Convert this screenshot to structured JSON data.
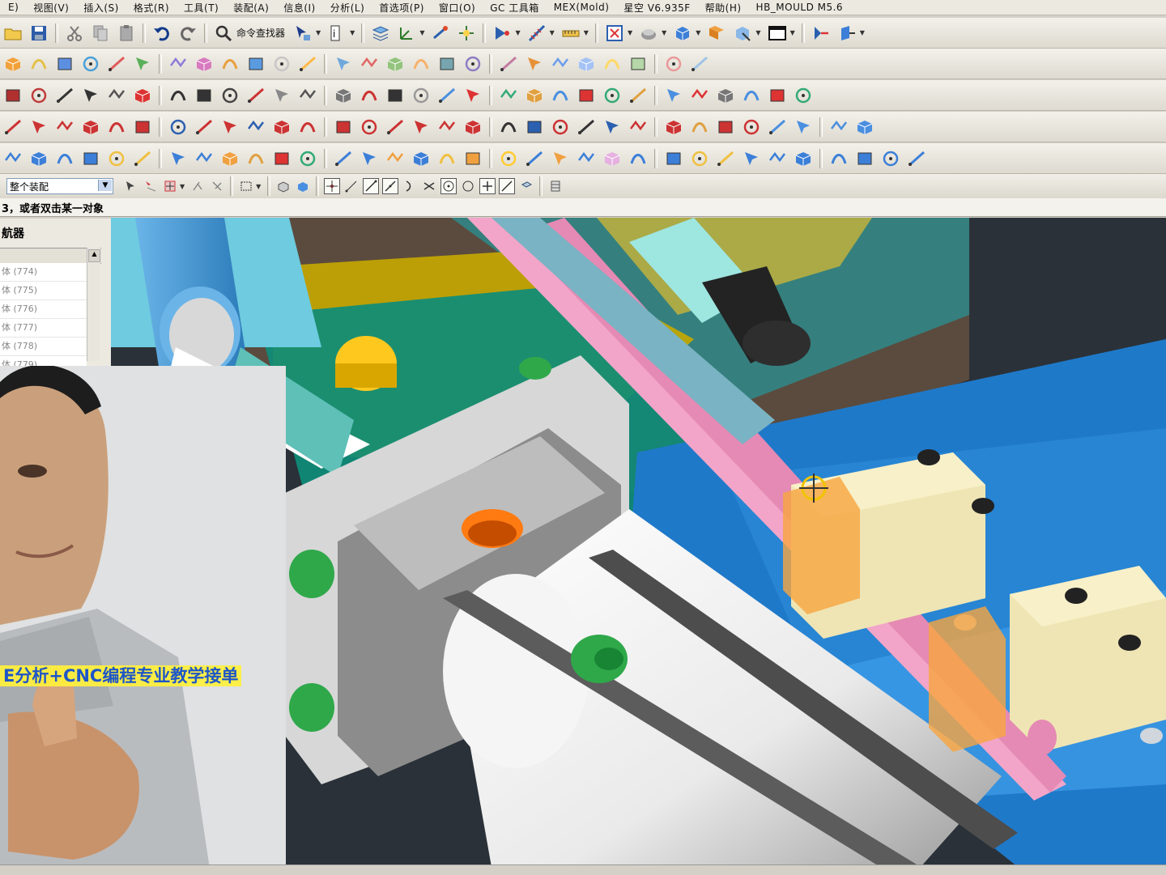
{
  "menubar": {
    "items": [
      "E)",
      "视图(V)",
      "插入(S)",
      "格式(R)",
      "工具(T)",
      "装配(A)",
      "信息(I)",
      "分析(L)",
      "首选项(P)",
      "窗口(O)",
      "GC 工具箱",
      "MEX(Mold)",
      "星空 V6.935F",
      "帮助(H)",
      "HB_MOULD M5.6"
    ]
  },
  "toolbar1": {
    "command_finder_label": "命令查找器"
  },
  "selection_bar": {
    "filter_value": "整个装配"
  },
  "cue_line": {
    "text": "3，或者双击某一对象"
  },
  "navigator": {
    "title": "航器",
    "rows": [
      "体 (774)",
      "体 (775)",
      "体 (776)",
      "体 (777)",
      "体 (778)",
      "体 (779)"
    ]
  },
  "overlay": {
    "caption": "E分析+CNC编程专业教学接单"
  },
  "colors": {
    "menubar_bg": "#ece9e0",
    "toolbar_bg": "#e4e1d8",
    "viewport_bg": "#2a3138",
    "caption_bg": "#fff03c",
    "caption_text": "#1e56c8"
  }
}
